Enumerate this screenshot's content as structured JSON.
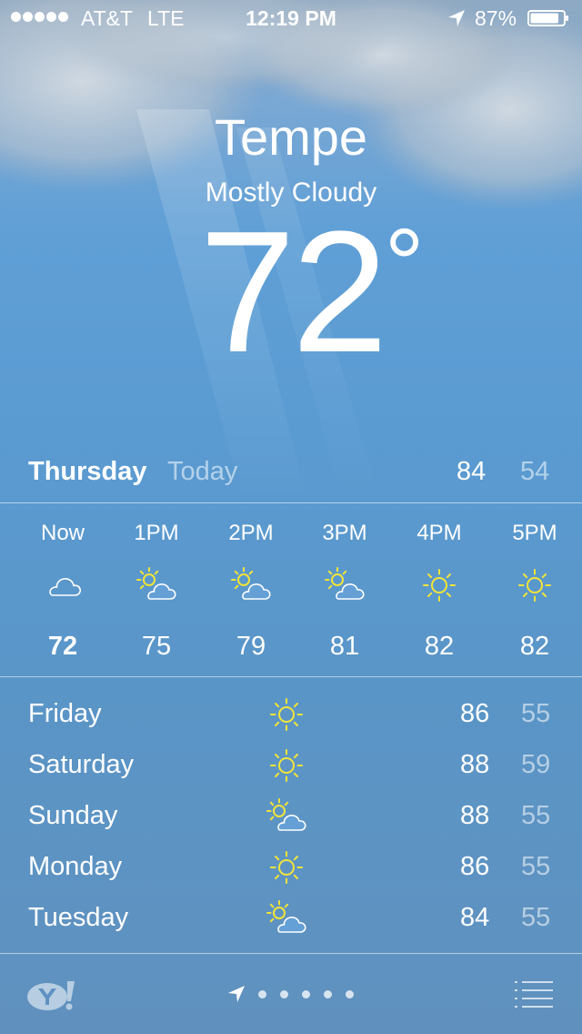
{
  "status_bar": {
    "carrier": "AT&T",
    "network": "LTE",
    "time": "12:19 PM",
    "battery_percent": "87%",
    "battery_level": 0.87,
    "signal_bars": 5
  },
  "current": {
    "city": "Tempe",
    "condition": "Mostly Cloudy",
    "temperature": "72",
    "degree_symbol": "°"
  },
  "today": {
    "day": "Thursday",
    "label": "Today",
    "high": "84",
    "low": "54"
  },
  "hourly": [
    {
      "time": "Now",
      "icon": "cloud-icon",
      "temp": "72"
    },
    {
      "time": "1PM",
      "icon": "partly-sunny-icon",
      "temp": "75"
    },
    {
      "time": "2PM",
      "icon": "partly-sunny-icon",
      "temp": "79"
    },
    {
      "time": "3PM",
      "icon": "partly-sunny-icon",
      "temp": "81"
    },
    {
      "time": "4PM",
      "icon": "sun-icon",
      "temp": "82"
    },
    {
      "time": "5PM",
      "icon": "sun-icon",
      "temp": "82"
    }
  ],
  "daily": [
    {
      "day": "Friday",
      "icon": "sun-icon",
      "high": "86",
      "low": "55"
    },
    {
      "day": "Saturday",
      "icon": "sun-icon",
      "high": "88",
      "low": "59"
    },
    {
      "day": "Sunday",
      "icon": "partly-sunny-icon",
      "high": "88",
      "low": "55"
    },
    {
      "day": "Monday",
      "icon": "sun-icon",
      "high": "86",
      "low": "55"
    },
    {
      "day": "Tuesday",
      "icon": "partly-sunny-icon",
      "high": "84",
      "low": "55"
    }
  ],
  "toolbar": {
    "logo_icon": "yahoo-logo-icon",
    "location_icon": "location-arrow-icon",
    "page_count": 5,
    "list_icon": "list-icon"
  },
  "colors": {
    "sun_yellow": "#f2e43a",
    "text_white": "#ffffff"
  }
}
